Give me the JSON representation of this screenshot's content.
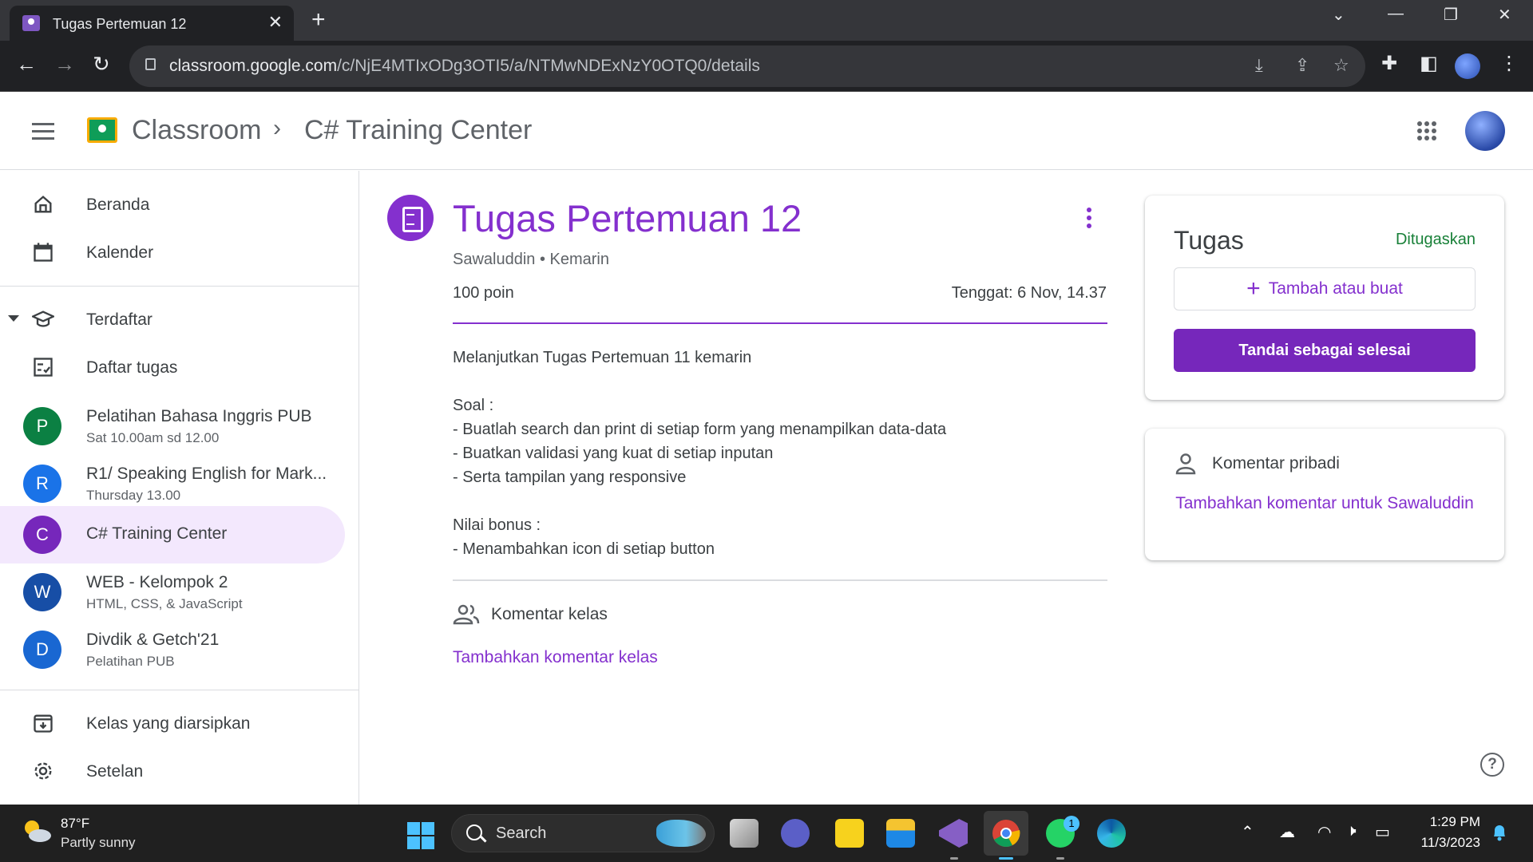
{
  "browser": {
    "tab_title": "Tugas Pertemuan 12",
    "tab_close": "✕",
    "new_tab": "+",
    "url_host": "classroom.google.com",
    "url_path": "/c/NjE4MTIxODg3OTI5/a/NTMwNDExNzY0OTQ0/details"
  },
  "header": {
    "brand": "Classroom",
    "separator": "›",
    "class_name": "C# Training Center"
  },
  "sidebar": {
    "items": [
      {
        "label": "Beranda",
        "icon": "home-icon"
      },
      {
        "label": "Kalender",
        "icon": "calendar-icon"
      }
    ],
    "enrolled_label": "Terdaftar",
    "todo_label": "Daftar tugas",
    "courses": [
      {
        "initial": "P",
        "name": "Pelatihan Bahasa Inggris PUB",
        "sub": "Sat 10.00am sd 12.00",
        "color": "#0b8043"
      },
      {
        "initial": "R",
        "name": "R1/ Speaking English for Mark...",
        "sub": "Thursday 13.00",
        "color": "#1a73e8"
      },
      {
        "initial": "C",
        "name": "C# Training Center",
        "sub": "",
        "color": "#7627bb",
        "active": true
      },
      {
        "initial": "W",
        "name": "WEB - Kelompok 2",
        "sub": "HTML, CSS, & JavaScript",
        "color": "#174ea6"
      },
      {
        "initial": "D",
        "name": "Divdik & Getch'21",
        "sub": "Pelatihan PUB",
        "color": "#1967d2"
      }
    ],
    "archived_label": "Kelas yang diarsipkan",
    "settings_label": "Setelan"
  },
  "assignment": {
    "title": "Tugas Pertemuan 12",
    "meta": "Sawaluddin • Kemarin",
    "points": "100 poin",
    "due": "Tenggat: 6 Nov, 14.37",
    "description": "Melanjutkan Tugas Pertemuan 11 kemarin\n\nSoal :\n- Buatlah search dan print di setiap form yang menampilkan data-data\n- Buatkan validasi yang kuat di setiap inputan\n- Serta tampilan yang responsive\n\nNilai bonus :\n- Menambahkan icon di setiap button",
    "class_comments_title": "Komentar kelas",
    "class_comments_link": "Tambahkan komentar kelas",
    "accent_color": "#8430ce"
  },
  "work_card": {
    "title": "Tugas",
    "status": "Ditugaskan",
    "add_plus": "+",
    "add_label": "Tambah atau buat",
    "done_label": "Tandai sebagai selesai"
  },
  "private_card": {
    "title": "Komentar pribadi",
    "link": "Tambahkan komentar untuk Sawaluddin"
  },
  "help": "?",
  "taskbar": {
    "temp": "87°F",
    "weather": "Partly sunny",
    "search": "Search",
    "notification_count": "1",
    "time": "1:29 PM",
    "date": "11/3/2023"
  }
}
